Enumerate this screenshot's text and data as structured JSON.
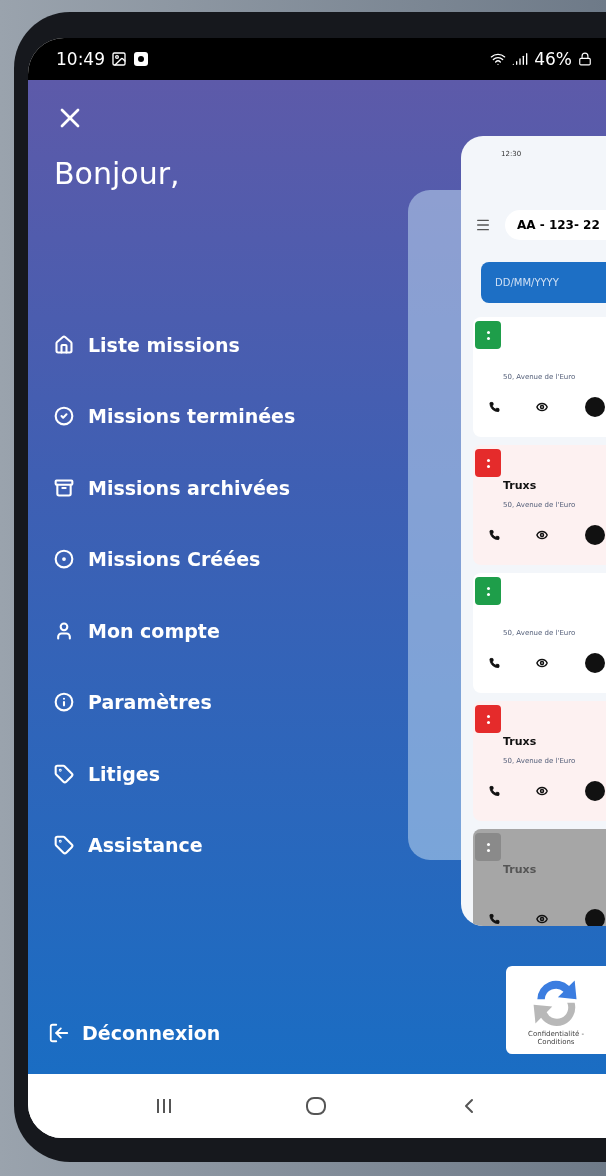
{
  "status_bar": {
    "time": "10:49",
    "battery": "46%"
  },
  "drawer": {
    "greeting": "Bonjour,",
    "items": [
      {
        "kind": "home",
        "label": "Liste missions"
      },
      {
        "kind": "check",
        "label": "Missions terminées"
      },
      {
        "kind": "archive",
        "label": "Missions archivées"
      },
      {
        "kind": "radio",
        "label": "Missions Créées"
      },
      {
        "kind": "person",
        "label": "Mon compte"
      },
      {
        "kind": "info",
        "label": "Paramètres"
      },
      {
        "kind": "tag",
        "label": "Litiges"
      },
      {
        "kind": "tag",
        "label": "Assistance"
      }
    ],
    "logout": "Déconnexion"
  },
  "preview": {
    "time": "12:30",
    "plate": "AA - 123- 22",
    "date_placeholder": "DD/MM/YYYY",
    "missions": [
      {
        "color": "#1e9e4a",
        "address": "50, Avenue de l'Euro",
        "disabled": false
      },
      {
        "color": "#e52b2b",
        "title": "Truxs",
        "address": "50, Avenue de l'Euro",
        "disabled": false
      },
      {
        "color": "#1e9e4a",
        "address": "50, Avenue de l'Euro",
        "disabled": false
      },
      {
        "color": "#e52b2b",
        "title": "Truxs",
        "address": "50, Avenue de l'Euro",
        "disabled": false
      },
      {
        "color": "#8a8a8a",
        "title": "Truxs",
        "disabled": true
      }
    ]
  },
  "recaptcha": {
    "text": "Confidentialité - Conditions"
  }
}
